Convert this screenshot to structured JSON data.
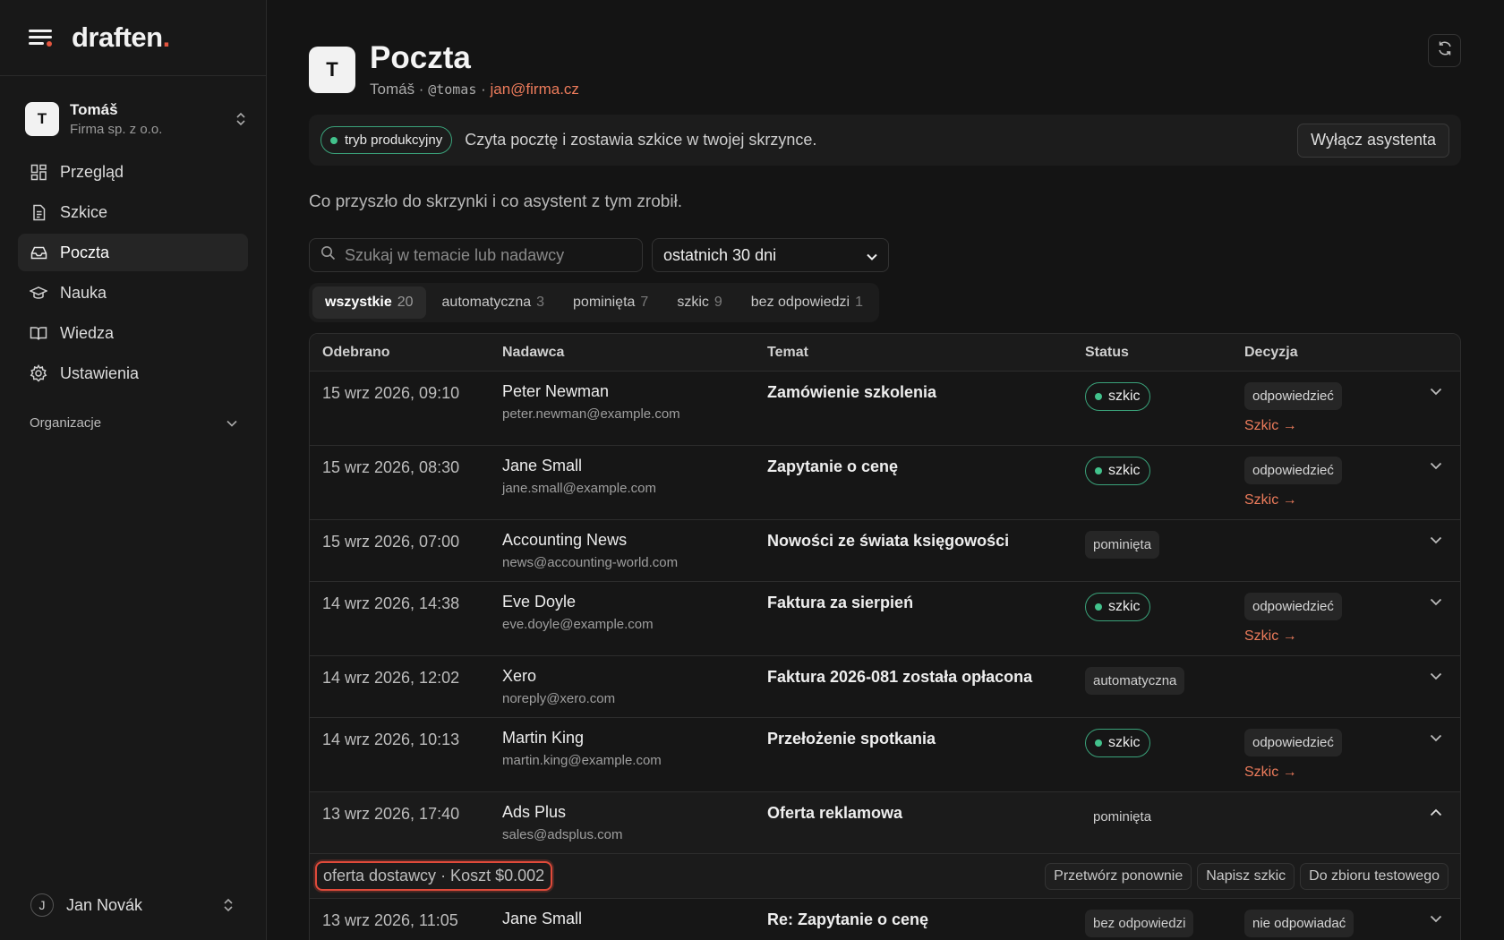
{
  "brand": {
    "name": "draften",
    "dot": "."
  },
  "org": {
    "initial": "T",
    "name": "Tomáš",
    "company": "Firma sp. z o.o."
  },
  "nav": [
    {
      "label": "Przegląd",
      "icon": "grid-icon"
    },
    {
      "label": "Szkice",
      "icon": "document-icon"
    },
    {
      "label": "Poczta",
      "icon": "inbox-icon"
    },
    {
      "label": "Nauka",
      "icon": "graduation-cap-icon"
    },
    {
      "label": "Wiedza",
      "icon": "book-icon"
    },
    {
      "label": "Ustawienia",
      "icon": "gear-icon"
    }
  ],
  "sidebar_section": "Organizacje",
  "user": {
    "initial": "J",
    "name": "Jan Novák"
  },
  "page": {
    "initial": "T",
    "title": "Poczta",
    "sub_name": "Tomáš",
    "sep": " · ",
    "handle": "@tomas",
    "email": "jan@firma.cz"
  },
  "banner": {
    "badge": "tryb produkcyjny",
    "text": "Czyta pocztę i zostawia szkice w twojej skrzynce.",
    "button": "Wyłącz asystenta"
  },
  "lead": "Co przyszło do skrzynki i co asystent z tym zrobił.",
  "search": {
    "placeholder": "Szukaj w temacie lub nadawcy"
  },
  "range": {
    "selected": "ostatnich 30 dni"
  },
  "tabs": [
    {
      "label": "wszystkie",
      "count": "20"
    },
    {
      "label": "automatyczna",
      "count": "3"
    },
    {
      "label": "pominięta",
      "count": "7"
    },
    {
      "label": "szkic",
      "count": "9"
    },
    {
      "label": "bez odpowiedzi",
      "count": "1"
    }
  ],
  "table": {
    "headers": {
      "received": "Odebrano",
      "sender": "Nadawca",
      "subject": "Temat",
      "status": "Status",
      "decision": "Decyzja"
    },
    "rows": [
      {
        "date": "15 wrz 2026, 09:10",
        "name": "Peter Newman",
        "email": "peter.newman@example.com",
        "subject": "Zamówienie szkolenia",
        "status": "szkic",
        "decision": "odpowiedzieć",
        "link": "Szkic →"
      },
      {
        "date": "15 wrz 2026, 08:30",
        "name": "Jane Small",
        "email": "jane.small@example.com",
        "subject": "Zapytanie o cenę",
        "status": "szkic",
        "decision": "odpowiedzieć",
        "link": "Szkic →"
      },
      {
        "date": "15 wrz 2026, 07:00",
        "name": "Accounting News",
        "email": "news@accounting-world.com",
        "subject": "Nowości ze świata księgowości",
        "status": "pominięta",
        "decision": "",
        "link": ""
      },
      {
        "date": "14 wrz 2026, 14:38",
        "name": "Eve Doyle",
        "email": "eve.doyle@example.com",
        "subject": "Faktura za sierpień",
        "status": "szkic",
        "decision": "odpowiedzieć",
        "link": "Szkic →"
      },
      {
        "date": "14 wrz 2026, 12:02",
        "name": "Xero",
        "email": "noreply@xero.com",
        "subject": "Faktura 2026-081 została opłacona",
        "status": "automatyczna",
        "decision": "",
        "link": ""
      },
      {
        "date": "14 wrz 2026, 10:13",
        "name": "Martin King",
        "email": "martin.king@example.com",
        "subject": "Przełożenie spotkania",
        "status": "szkic",
        "decision": "odpowiedzieć",
        "link": "Szkic →"
      },
      {
        "date": "13 wrz 2026, 17:40",
        "name": "Ads Plus",
        "email": "sales@adsplus.com",
        "subject": "Oferta reklamowa",
        "status": "pominięta",
        "decision": "",
        "link": ""
      },
      {
        "date": "13 wrz 2026, 11:05",
        "name": "Jane Small",
        "email": "",
        "subject": "Re: Zapytanie o cenę",
        "status": "bez odpowiedzi",
        "decision": "nie odpowiadać",
        "link": ""
      }
    ],
    "expanded": {
      "meta": "oferta dostawcy · Koszt $0.002",
      "actions": [
        "Przetwórz ponownie",
        "Napisz szkic",
        "Do zbioru testowego"
      ]
    }
  },
  "colors": {
    "accent": "#e2553f",
    "link": "#ec7b5b",
    "green": "#42c28c",
    "bg": "#141414"
  }
}
